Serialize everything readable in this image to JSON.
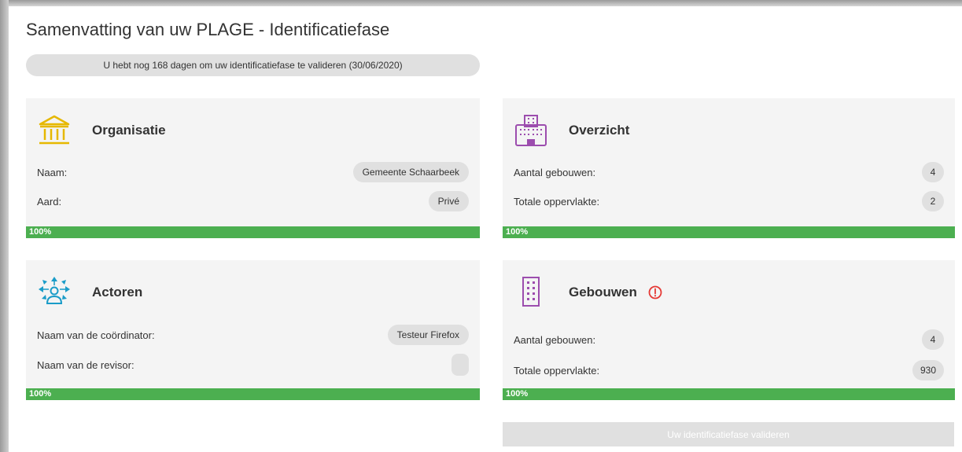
{
  "page": {
    "title": "Samenvatting van uw PLAGE - Identificatiefase",
    "deadline_text": "U hebt nog 168 dagen om uw identificatiefase te valideren (30/06/2020)"
  },
  "cards": {
    "organisatie": {
      "icon": "institution-icon",
      "icon_color": "#e6b800",
      "title": "Organisatie",
      "rows": [
        {
          "label": "Naam:",
          "value": "Gemeente Schaarbeek"
        },
        {
          "label": "Aard:",
          "value": "Privé"
        }
      ],
      "progress_label": "100%",
      "progress": 1.0
    },
    "overzicht": {
      "icon": "office-building-icon",
      "icon_color": "#9c4dae",
      "title": "Overzicht",
      "rows": [
        {
          "label": "Aantal gebouwen:",
          "value": "4"
        },
        {
          "label": "Totale oppervlakte:",
          "value": "2"
        }
      ],
      "progress_label": "100%",
      "progress": 1.0
    },
    "actoren": {
      "icon": "actors-network-icon",
      "icon_color": "#1a9cc8",
      "title": "Actoren",
      "rows": [
        {
          "label": "Naam van de coördinator:",
          "value": "Testeur Firefox"
        },
        {
          "label": "Naam van de revisor:",
          "value": ""
        }
      ],
      "progress_label": "100%",
      "progress": 1.0
    },
    "gebouwen": {
      "icon": "building-icon",
      "icon_color": "#9c4dae",
      "title": "Gebouwen",
      "warning_icon": "alert-circle-icon",
      "warning_color": "#e53935",
      "rows": [
        {
          "label": "Aantal gebouwen:",
          "value": "4"
        },
        {
          "label": "Totale oppervlakte:",
          "value": "930"
        }
      ],
      "progress_label": "100%",
      "progress": 1.0
    }
  },
  "actions": {
    "validate_label": "Uw identificatiefase valideren"
  },
  "colors": {
    "progress_green": "#4caf50",
    "card_background": "#f4f4f4",
    "pill_background": "#e0e0e0"
  }
}
